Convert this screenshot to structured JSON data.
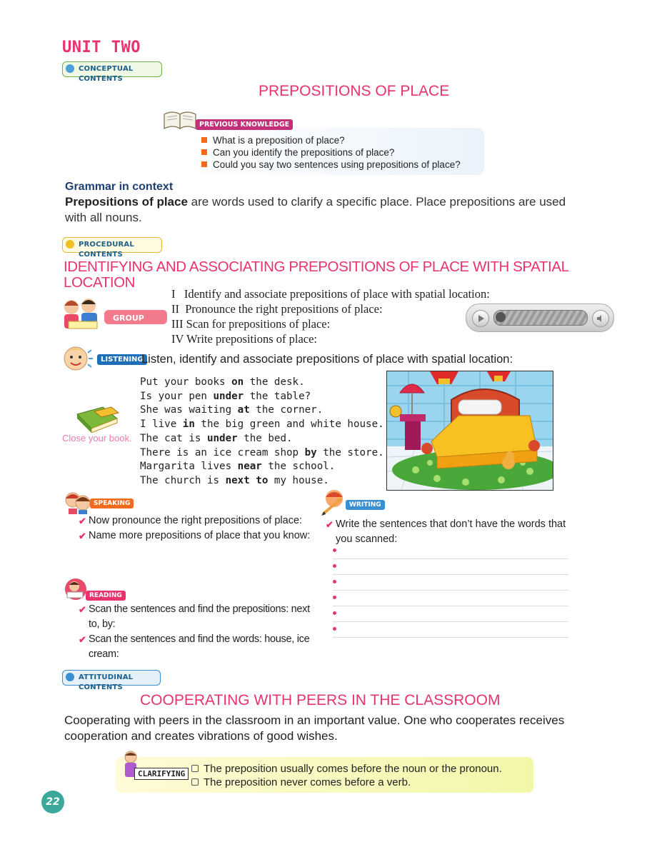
{
  "header": {
    "unit": "UNIT TWO",
    "conceptual_tag": "CONCEPTUAL CONTENTS"
  },
  "main_title": "PREPOSITIONS OF PLACE",
  "previous_knowledge": {
    "label": "PREVIOUS KNOWLEDGE",
    "items": [
      "What is a preposition of place?",
      "Can you identify the prepositions of place?",
      "Could you say two sentences using prepositions of place?"
    ]
  },
  "grammar": {
    "heading": "Grammar in context",
    "bold_term": "Prepositions of place",
    "text": " are words used to clarify a specific place. Place prepositions are used with all nouns."
  },
  "procedural": {
    "tag": "PROCEDURAL CONTENTS",
    "title_line1": "IDENTIFYING AND ASSOCIATING PREPOSITIONS OF PLACE WITH SPATIAL",
    "title_line2": "LOCATION",
    "group_work": "GROUP WORK",
    "steps": [
      "I   Identify and associate prepositions of place with spatial location:",
      "II  Pronounce the right prepositions of place:",
      "III Scan for prepositions of place:",
      "IV Write prepositions of place:"
    ]
  },
  "listening": {
    "label": "LISTENING",
    "instruction": "Listen, identify and associate prepositions of place with spatial location:",
    "close_book": "Close your book.",
    "sentences": [
      [
        "Put your books ",
        "on",
        " the desk."
      ],
      [
        "Is your pen ",
        "under",
        " the table?"
      ],
      [
        "She was waiting ",
        "at",
        " the corner."
      ],
      [
        "I live ",
        "in",
        " the big green and white house."
      ],
      [
        "The cat is ",
        "under",
        " the bed."
      ],
      [
        "There is an ice cream shop ",
        "by",
        " the store."
      ],
      [
        "Margarita lives ",
        "near",
        " the school."
      ],
      [
        "The church is ",
        "next to",
        " my house."
      ]
    ]
  },
  "speaking": {
    "label": "SPEAKING",
    "items": [
      "Now pronounce the right prepositions of place:",
      "Name more prepositions of place that you know:"
    ]
  },
  "reading": {
    "label": "READING",
    "items": [
      "Scan the sentences and find the prepositions: next to, by:",
      "Scan the sentences and find the words: house, ice cream:"
    ]
  },
  "writing": {
    "label": "WRITING",
    "instruction": "Write the sentences that don’t have the words that you scanned:"
  },
  "attitudinal": {
    "tag": "ATTITUDINAL CONTENTS",
    "title": "COOPERATING WITH PEERS IN THE CLASSROOM",
    "text": "Cooperating with peers in the classroom in an important value. One who cooperates receives cooperation and creates vibrations of good wishes."
  },
  "clarifying": {
    "label": "CLARIFYING",
    "items": [
      "The preposition usually comes before the noun or the pronoun.",
      "The preposition never comes before a verb."
    ]
  },
  "page_number": "22",
  "colors": {
    "pink": "#e8336d",
    "navy": "#1d3f72",
    "orange": "#f26a1b",
    "green": "#6fb24a"
  }
}
